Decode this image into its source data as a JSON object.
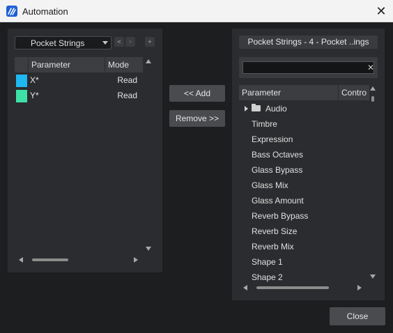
{
  "window": {
    "title": "Automation",
    "close_label": "✕"
  },
  "left_panel": {
    "track_dropdown": "Pocket Strings",
    "nav_prev": "<",
    "nav_next": ">",
    "add_small": "+",
    "columns": [
      "Parameter",
      "Mode"
    ],
    "rows": [
      {
        "name": "X*",
        "mode": "Read",
        "color": "#1fb8f0"
      },
      {
        "name": "Y*",
        "mode": "Read",
        "color": "#3ee0a8"
      }
    ]
  },
  "middle": {
    "add_label": "<< Add",
    "remove_label": "Remove >>"
  },
  "right_panel": {
    "title": "Pocket Strings - 4 - Pocket ..ings",
    "search": {
      "value": "",
      "placeholder": "",
      "clear": "✕"
    },
    "columns": [
      "Parameter",
      "Contro"
    ],
    "folder": "Audio",
    "parameters": [
      "Timbre",
      "Expression",
      "Bass Octaves",
      "Glass Bypass",
      "Glass Mix",
      "Glass Amount",
      "Reverb Bypass",
      "Reverb Size",
      "Reverb Mix",
      "Shape 1",
      "Shape 2"
    ]
  },
  "footer": {
    "close_label": "Close"
  }
}
